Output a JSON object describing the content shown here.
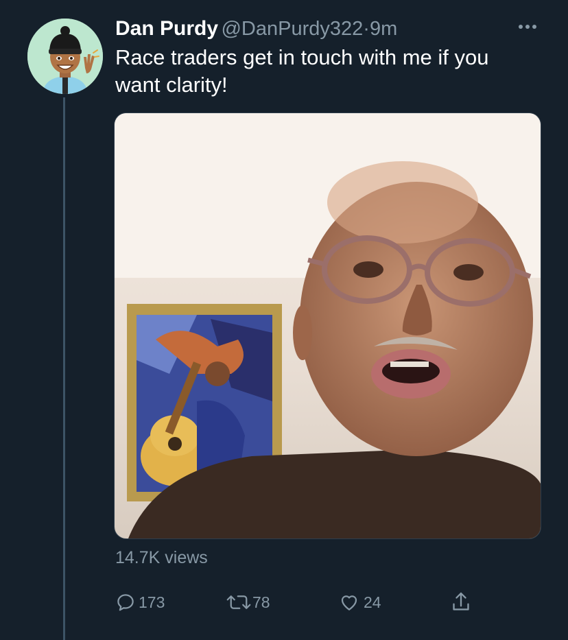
{
  "tweet": {
    "author_name": "Dan Purdy",
    "handle": "@DanPurdy322",
    "separator": "·",
    "time": "9m",
    "text": "Race traders get in touch with me if you want clarity!",
    "more_icon": "more-horizontal-icon"
  },
  "media": {
    "views": "14.7K views"
  },
  "actions": {
    "reply": {
      "icon": "reply-icon",
      "count": "173"
    },
    "retweet": {
      "icon": "retweet-icon",
      "count": "78"
    },
    "like": {
      "icon": "heart-icon",
      "count": "24"
    },
    "share": {
      "icon": "share-icon"
    }
  },
  "colors": {
    "background": "#15202b",
    "secondary_text": "#8899a6",
    "primary_text": "#ffffff",
    "thread_line": "#3d5466"
  }
}
